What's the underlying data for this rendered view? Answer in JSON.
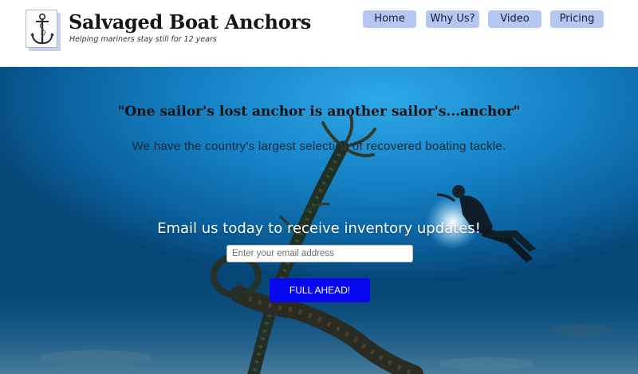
{
  "header": {
    "title": "Salvaged Boat Anchors",
    "tagline": "Helping mariners stay still for 12 years",
    "logo_icon": "anchor-icon"
  },
  "nav": {
    "home": "Home",
    "why_us": "Why Us?",
    "video": "Video",
    "pricing": "Pricing"
  },
  "hero": {
    "quote": "\"One sailor's lost anchor is another sailor's...anchor\"",
    "subtext": "We have the country's largest selection of recovered boating tackle.",
    "email_heading": "Email us today to receive inventory updates!",
    "email_placeholder": "Enter your email address",
    "email_value": "",
    "cta_label": "FULL AHEAD!"
  },
  "colors": {
    "nav_bg": "#b4c6f4",
    "cta_bg": "#0707f0",
    "water": "#1582c6"
  }
}
